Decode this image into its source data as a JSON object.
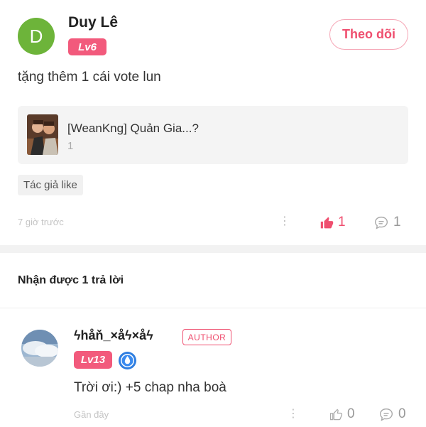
{
  "post": {
    "avatar_letter": "D",
    "username": "Duy Lê",
    "level": "Lv6",
    "follow_label": "Theo dõi",
    "text": "tặng thêm 1 cái vote lun",
    "quote": {
      "title": "[WeanKng] Quản Gia...?",
      "subtitle": "1"
    },
    "tag": "Tác giả like",
    "time": "7 giờ trước",
    "like_count": "1",
    "comment_count": "1"
  },
  "replies": {
    "header": "Nhận được 1 trả lời",
    "items": [
      {
        "username": "ϟhåň_×åϟ×åϟ",
        "author_badge": "AUTHOR",
        "level": "Lv13",
        "text": "Trời ơi:) +5 chap nha boà",
        "time": "Gần đây",
        "like_count": "0",
        "comment_count": "0"
      }
    ]
  },
  "colors": {
    "accent": "#ef4f6f",
    "level_badge": "#f25a7c",
    "avatar_green": "#6db43a",
    "card_bg": "#f4f4f4"
  }
}
